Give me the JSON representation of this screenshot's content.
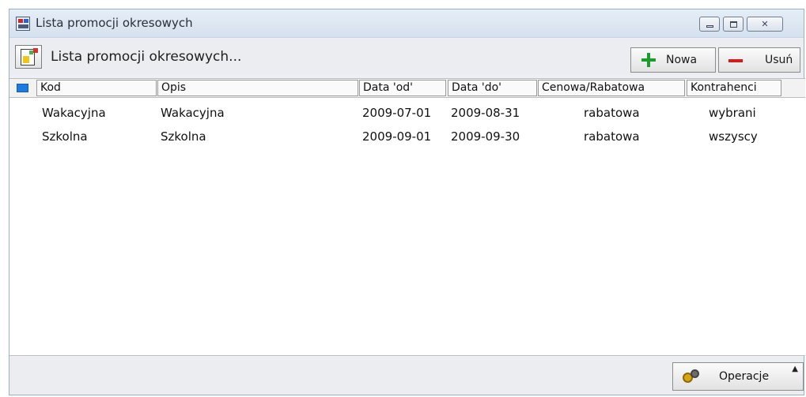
{
  "window": {
    "title": "Lista promocji okresowych",
    "icon": "app-window-icon",
    "controls": [
      "minimize-icon",
      "maximize-icon",
      "close-icon"
    ],
    "close_glyph": "✕"
  },
  "toolbar": {
    "title": "Lista promocji okresowych...",
    "new_label": "Nowa",
    "delete_label": "Usuń"
  },
  "table": {
    "columns": [
      "Kod",
      "Opis",
      "Data 'od'",
      "Data 'do'",
      "Cenowa/Rabatowa",
      "Kontrahenci"
    ],
    "rows": [
      {
        "kod": "Wakacyjna",
        "opis": "Wakacyjna",
        "od": "2009-07-01",
        "do": "2009-08-31",
        "typ": "rabatowa",
        "kontrahenci": "wybrani"
      },
      {
        "kod": "Szkolna",
        "opis": "Szkolna",
        "od": "2009-09-01",
        "do": "2009-09-30",
        "typ": "rabatowa",
        "kontrahenci": "wszyscy"
      }
    ]
  },
  "status": {
    "operations_label": "Operacje",
    "caret": "▲"
  },
  "colors": {
    "selection_marker": "#1f7ae0",
    "add": "#1e9b2f",
    "delete": "#d71a1a"
  }
}
